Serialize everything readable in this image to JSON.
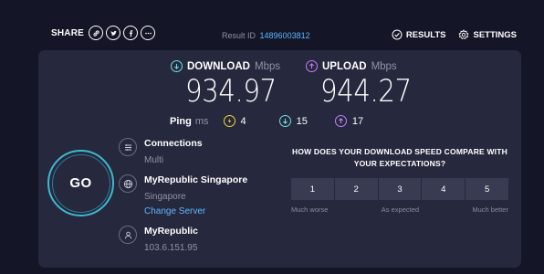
{
  "header": {
    "share_label": "SHARE",
    "share_icons": [
      "link-icon",
      "twitter-icon",
      "facebook-icon",
      "more-icon"
    ],
    "result_label": "Result ID",
    "result_id": "14896003812",
    "results_label": "RESULTS",
    "settings_label": "SETTINGS"
  },
  "download": {
    "label": "DOWNLOAD",
    "unit": "Mbps",
    "value": "934.97",
    "color": "#6fe0e6"
  },
  "upload": {
    "label": "UPLOAD",
    "unit": "Mbps",
    "value": "944.27",
    "color": "#c281f9"
  },
  "ping": {
    "label": "Ping",
    "unit": "ms",
    "idle": "4",
    "download": "15",
    "upload": "17",
    "idle_color": "#f5d33a"
  },
  "go_label": "GO",
  "connections": {
    "title": "Connections",
    "value": "Multi"
  },
  "server": {
    "title": "MyRepublic Singapore",
    "location": "Singapore",
    "change_label": "Change Server"
  },
  "provider": {
    "title": "MyRepublic",
    "ip": "103.6.151.95"
  },
  "survey": {
    "question": "HOW DOES YOUR DOWNLOAD SPEED COMPARE WITH YOUR EXPECTATIONS?",
    "options": [
      "1",
      "2",
      "3",
      "4",
      "5"
    ],
    "low_label": "Much worse",
    "mid_label": "As expected",
    "high_label": "Much better"
  }
}
